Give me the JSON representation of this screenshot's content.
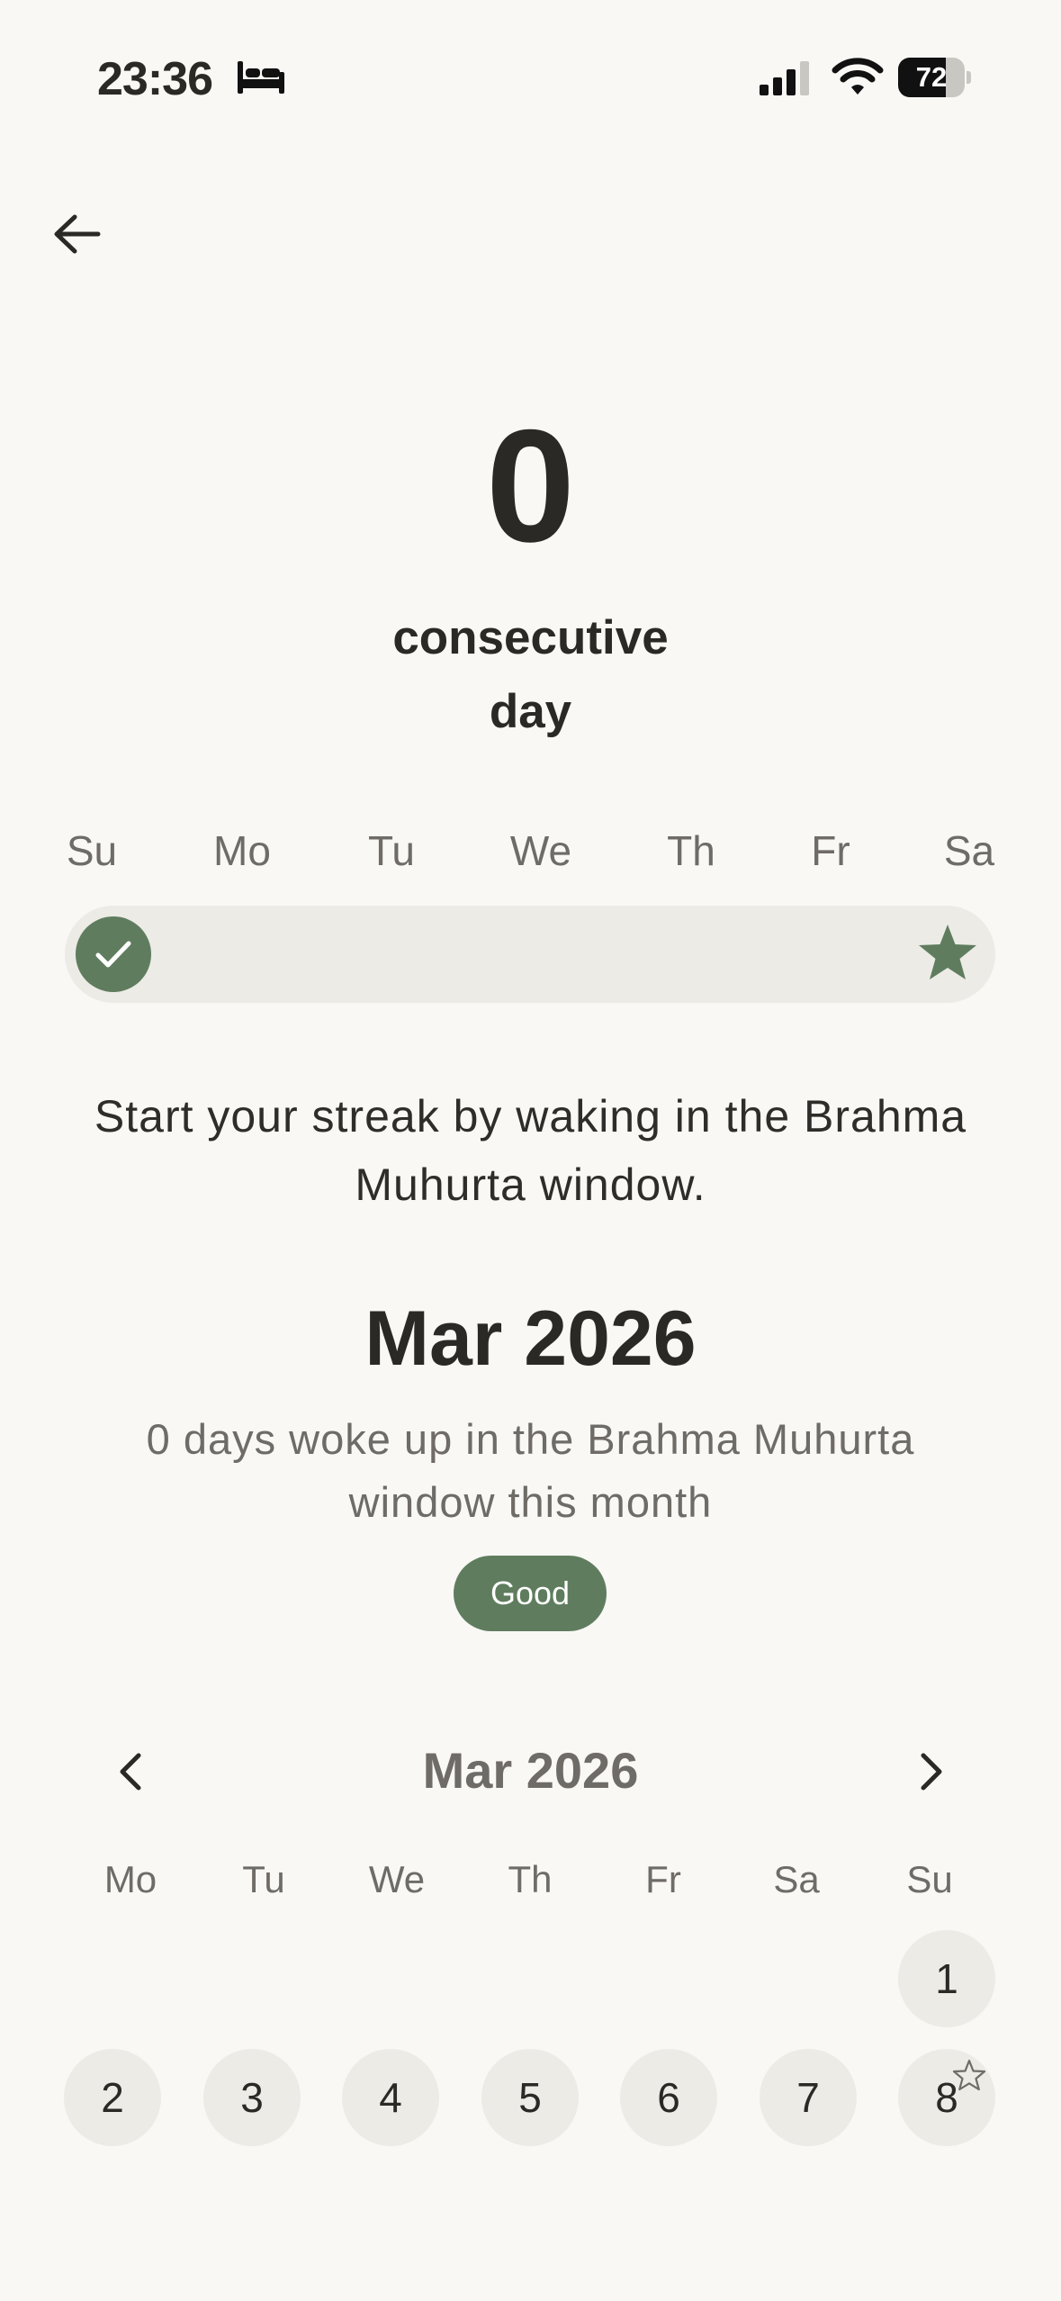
{
  "status_bar": {
    "time": "23:36",
    "battery": "72",
    "battery_level": 0.72,
    "icons": [
      "bed-icon",
      "cellular-signal-icon",
      "wifi-icon",
      "battery-icon"
    ]
  },
  "header": {
    "back_icon": "arrow-left-icon"
  },
  "streak": {
    "count": "0",
    "label_line1": "consecutive",
    "label_line2": "day"
  },
  "week": {
    "days": [
      "Su",
      "Mo",
      "Tu",
      "We",
      "Th",
      "Fr",
      "Sa"
    ],
    "completed_icon": "check-icon",
    "goal_icon": "star-icon"
  },
  "hint": "Start your streak by waking in the Brahma Muhurta window.",
  "summary": {
    "month": "Mar 2026",
    "description": "0 days woke up in the Brahma Muhurta window this month",
    "badge": "Good"
  },
  "calendar": {
    "title": "Mar 2026",
    "prev_icon": "chevron-left-icon",
    "next_icon": "chevron-right-icon",
    "weekday_headers": [
      "Mo",
      "Tu",
      "We",
      "Th",
      "Fr",
      "Sa",
      "Su"
    ],
    "days": [
      "1",
      "2",
      "3",
      "4",
      "5",
      "6",
      "7",
      "8"
    ],
    "starred_day_icon": "star-outline-icon"
  },
  "colors": {
    "background": "#f9f8f5",
    "accent_green": "#5f7d5e",
    "track": "#ecebe6",
    "text_dark": "#2b2926",
    "text_muted": "#6f6b66"
  }
}
